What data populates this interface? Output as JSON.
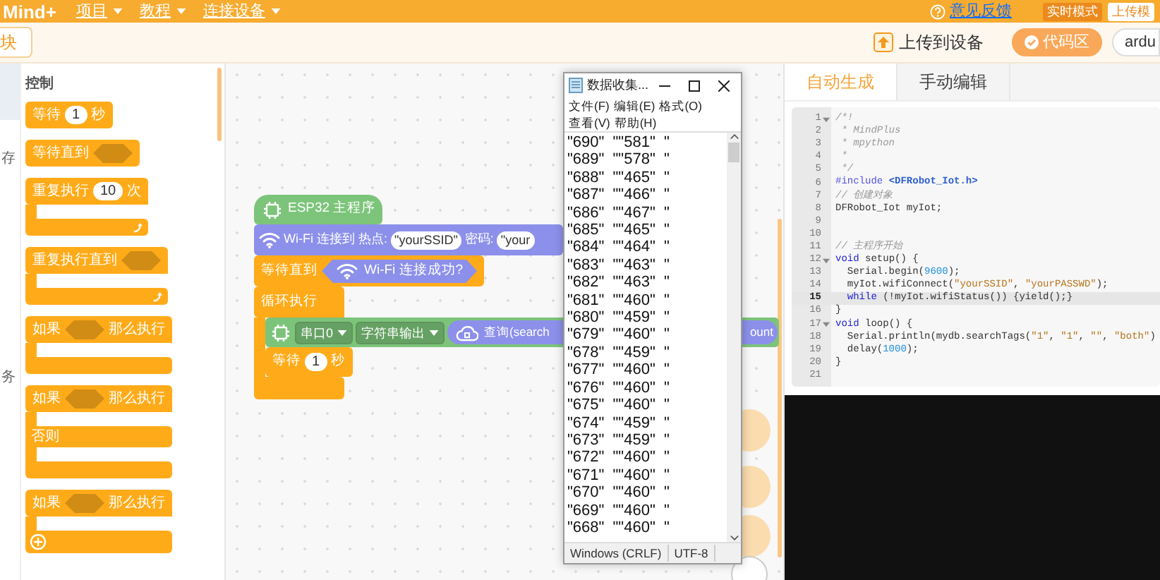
{
  "menu_bar": {
    "logo": "Mind+",
    "menus": [
      {
        "label": "项目"
      },
      {
        "label": "教程"
      },
      {
        "label": "连接设备"
      }
    ],
    "feedback": "意见反馈",
    "modes": [
      {
        "label": "实时模式",
        "selected": false
      },
      {
        "label": "上传模",
        "selected": true
      }
    ]
  },
  "toolbar": {
    "blocks_tab": "块",
    "upload": "上传到设备",
    "code_area": {
      "label": "代码区",
      "on": true
    },
    "board": "ardu"
  },
  "categories": [
    {
      "label": "存"
    },
    {
      "label": "务"
    }
  ],
  "palette": {
    "title": "控制",
    "blocks": [
      {
        "kind": "stack",
        "color": "#ffab19",
        "head": [
          {
            "kind": "text",
            "text": "等待"
          },
          {
            "kind": "number",
            "text": "1"
          },
          {
            "kind": "text",
            "text": "秒"
          }
        ]
      },
      {
        "kind": "stack",
        "color": "#ffab19",
        "head": [
          {
            "kind": "text",
            "text": "等待直到"
          },
          {
            "kind": "slot"
          }
        ]
      },
      {
        "kind": "c",
        "color": "#ffab19",
        "loop_arrow": true,
        "head": [
          {
            "kind": "text",
            "text": "重复执行"
          },
          {
            "kind": "number",
            "text": "10"
          },
          {
            "kind": "text",
            "text": "次"
          }
        ]
      },
      {
        "kind": "c",
        "color": "#ffab19",
        "loop_arrow": true,
        "head": [
          {
            "kind": "text",
            "text": "重复执行直到"
          },
          {
            "kind": "slot"
          }
        ]
      },
      {
        "kind": "c",
        "color": "#ffab19",
        "head": [
          {
            "kind": "text",
            "text": "如果"
          },
          {
            "kind": "slot"
          },
          {
            "kind": "text",
            "text": "那么执行"
          }
        ]
      },
      {
        "kind": "c",
        "color": "#ffab19",
        "else": "否则",
        "head": [
          {
            "kind": "text",
            "text": "如果"
          },
          {
            "kind": "slot"
          },
          {
            "kind": "text",
            "text": "那么执行"
          }
        ]
      },
      {
        "kind": "c",
        "color": "#ffab19",
        "plus": true,
        "head": [
          {
            "kind": "text",
            "text": "如果"
          },
          {
            "kind": "slot"
          },
          {
            "kind": "text",
            "text": "那么执行"
          }
        ]
      }
    ]
  },
  "script": [
    {
      "kind": "hat",
      "color": "#7cc47a",
      "head": [
        {
          "kind": "chip"
        },
        {
          "kind": "text",
          "text": "ESP32 主程序"
        }
      ]
    },
    {
      "kind": "stack",
      "color": "#8c90ea",
      "head": [
        {
          "kind": "wifi"
        },
        {
          "kind": "text",
          "text": "Wi-Fi 连接到 热点:"
        },
        {
          "kind": "string",
          "text": "\"yourSSID\""
        },
        {
          "kind": "text",
          "text": "密码:"
        },
        {
          "kind": "string",
          "text": "\"your"
        }
      ]
    },
    {
      "kind": "stack",
      "color": "#ffab19",
      "head": [
        {
          "kind": "text",
          "text": "等待直到"
        },
        {
          "kind": "condition",
          "color": "#8c90ea",
          "parts": [
            {
              "kind": "wifi"
            },
            {
              "kind": "text",
              "text": "Wi-Fi 连接成功?"
            }
          ]
        }
      ]
    },
    {
      "kind": "c",
      "color": "#ffab19",
      "head": [
        {
          "kind": "text",
          "text": "循环执行"
        }
      ],
      "body": [
        {
          "kind": "stack",
          "color": "#7cc47a",
          "head": [
            {
              "kind": "chip"
            },
            {
              "kind": "dropdown",
              "text": "串口0"
            },
            {
              "kind": "dropdown",
              "text": "字符串输出"
            },
            {
              "kind": "reporter",
              "color": "#8c90ea",
              "parts": [
                {
                  "kind": "cloud"
                },
                {
                  "kind": "text",
                  "text": "查询(search"
                },
                {
                  "kind": "text",
                  "text": "ount"
                }
              ]
            }
          ]
        },
        {
          "kind": "stack",
          "color": "#ffab19",
          "head": [
            {
              "kind": "text",
              "text": "等待"
            },
            {
              "kind": "number",
              "text": "1"
            },
            {
              "kind": "text",
              "text": "秒"
            }
          ]
        }
      ]
    }
  ],
  "notepad": {
    "title": "数据收集...",
    "menus": [
      "文件(F)",
      "编辑(E)",
      "格式(O)",
      "查看(V)",
      "帮助(H)"
    ],
    "lines": [
      "\"690\"  \"\"581\"  \"",
      "\"689\"  \"\"578\"  \"",
      "\"688\"  \"\"465\"  \"",
      "\"687\"  \"\"466\"  \"",
      "\"686\"  \"\"467\"  \"",
      "\"685\"  \"\"465\"  \"",
      "\"684\"  \"\"464\"  \"",
      "\"683\"  \"\"463\"  \"",
      "\"682\"  \"\"463\"  \"",
      "\"681\"  \"\"460\"  \"",
      "\"680\"  \"\"459\"  \"",
      "\"679\"  \"\"460\"  \"",
      "\"678\"  \"\"459\"  \"",
      "\"677\"  \"\"460\"  \"",
      "\"676\"  \"\"460\"  \"",
      "\"675\"  \"\"460\"  \"",
      "\"674\"  \"\"459\"  \"",
      "\"673\"  \"\"459\"  \"",
      "\"672\"  \"\"460\"  \"",
      "\"671\"  \"\"460\"  \"",
      "\"670\"  \"\"460\"  \"",
      "\"669\"  \"\"460\"  \"",
      "\"668\"  \"\"460\"  \""
    ],
    "status": [
      "Windows (CRLF)",
      "UTF-8"
    ]
  },
  "code_panel": {
    "tabs": [
      {
        "label": "自动生成",
        "selected": true
      },
      {
        "label": "手动编辑",
        "selected": false
      }
    ],
    "lines": [
      {
        "number": "1",
        "fold": true,
        "active": false,
        "tokens": [
          {
            "kind": "comment",
            "text": "/*!"
          }
        ]
      },
      {
        "number": "2",
        "fold": false,
        "active": false,
        "tokens": [
          {
            "kind": "comment",
            "text": " * MindPlus"
          }
        ]
      },
      {
        "number": "3",
        "fold": false,
        "active": false,
        "tokens": [
          {
            "kind": "comment",
            "text": " * mpython"
          }
        ]
      },
      {
        "number": "4",
        "fold": false,
        "active": false,
        "tokens": [
          {
            "kind": "comment",
            "text": " *"
          }
        ]
      },
      {
        "number": "5",
        "fold": false,
        "active": false,
        "tokens": [
          {
            "kind": "comment",
            "text": " */"
          }
        ]
      },
      {
        "number": "6",
        "fold": false,
        "active": false,
        "tokens": [
          {
            "kind": "directive",
            "text": "#include "
          },
          {
            "kind": "header",
            "text": "<DFRobot_Iot.h>"
          }
        ]
      },
      {
        "number": "7",
        "fold": false,
        "active": false,
        "tokens": [
          {
            "kind": "comment",
            "text": "// 创建对象"
          }
        ]
      },
      {
        "number": "8",
        "fold": false,
        "active": false,
        "tokens": [
          {
            "kind": "plain",
            "text": "DFRobot_Iot myIot;"
          }
        ]
      },
      {
        "number": "9",
        "fold": false,
        "active": false
      },
      {
        "number": "10",
        "fold": false,
        "active": false
      },
      {
        "number": "11",
        "fold": false,
        "active": false,
        "tokens": [
          {
            "kind": "comment",
            "text": "// 主程序开始"
          }
        ]
      },
      {
        "number": "12",
        "fold": true,
        "active": false,
        "tokens": [
          {
            "kind": "keyword",
            "text": "void"
          },
          {
            "kind": "plain",
            "text": " setup() {"
          }
        ]
      },
      {
        "number": "13",
        "fold": false,
        "active": false,
        "tokens": [
          {
            "kind": "plain",
            "text": "  Serial.begin("
          },
          {
            "kind": "number",
            "text": "9600"
          },
          {
            "kind": "plain",
            "text": ");"
          }
        ]
      },
      {
        "number": "14",
        "fold": false,
        "active": false,
        "tokens": [
          {
            "kind": "plain",
            "text": "  myIot.wifiConnect("
          },
          {
            "kind": "string",
            "text": "\"yourSSID\""
          },
          {
            "kind": "plain",
            "text": ", "
          },
          {
            "kind": "string",
            "text": "\"yourPASSWD\""
          },
          {
            "kind": "plain",
            "text": ");"
          }
        ]
      },
      {
        "number": "15",
        "fold": false,
        "active": true,
        "tokens": [
          {
            "kind": "keyword",
            "text": "  while"
          },
          {
            "kind": "plain",
            "text": " (!myIot.wifiStatus()) {yield();}"
          }
        ]
      },
      {
        "number": "16",
        "fold": false,
        "active": false,
        "tokens": [
          {
            "kind": "plain",
            "text": "}"
          }
        ]
      },
      {
        "number": "17",
        "fold": true,
        "active": false,
        "tokens": [
          {
            "kind": "keyword",
            "text": "void"
          },
          {
            "kind": "plain",
            "text": " loop() {"
          }
        ]
      },
      {
        "number": "18",
        "fold": false,
        "active": false,
        "tokens": [
          {
            "kind": "plain",
            "text": "  Serial.println(mydb.searchTags("
          },
          {
            "kind": "string",
            "text": "\"1\""
          },
          {
            "kind": "plain",
            "text": ", "
          },
          {
            "kind": "string",
            "text": "\"1\""
          },
          {
            "kind": "plain",
            "text": ", "
          },
          {
            "kind": "string",
            "text": "\"\""
          },
          {
            "kind": "plain",
            "text": ", "
          },
          {
            "kind": "string",
            "text": "\"both\""
          },
          {
            "kind": "plain",
            "text": ")"
          }
        ]
      },
      {
        "number": "19",
        "fold": false,
        "active": false,
        "tokens": [
          {
            "kind": "plain",
            "text": "  delay("
          },
          {
            "kind": "number",
            "text": "1000"
          },
          {
            "kind": "plain",
            "text": ");"
          }
        ]
      },
      {
        "number": "20",
        "fold": false,
        "active": false,
        "tokens": [
          {
            "kind": "plain",
            "text": "}"
          }
        ]
      },
      {
        "number": "21",
        "fold": false,
        "active": false
      }
    ]
  }
}
